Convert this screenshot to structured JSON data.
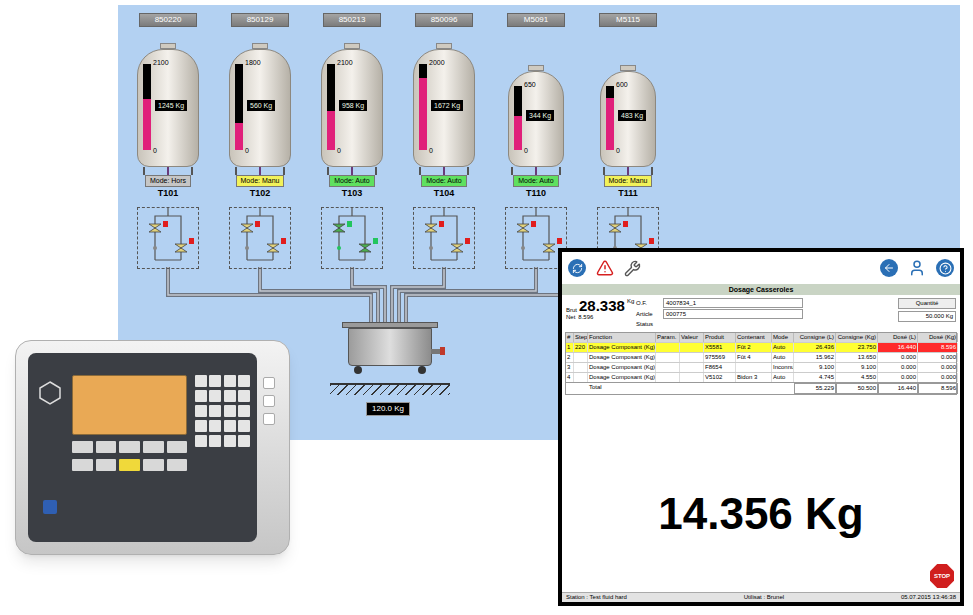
{
  "diagram": {
    "tanks": [
      {
        "code": "850220",
        "max": "2100",
        "min": "0",
        "reading": "1245 Kg",
        "level": 0.593,
        "mode": "Mode: Hors",
        "color": "#c6c6c6",
        "name": "T101",
        "valve_open": false
      },
      {
        "code": "850129",
        "max": "1800",
        "min": "0",
        "reading": "560 Kg",
        "level": 0.311,
        "mode": "Mode: Manu",
        "color": "#f2f25a",
        "name": "T102",
        "valve_open": false
      },
      {
        "code": "850213",
        "max": "2100",
        "min": "0",
        "reading": "958 Kg",
        "level": 0.456,
        "mode": "Mode: Auto",
        "color": "#5fe05f",
        "name": "T103",
        "valve_open": true
      },
      {
        "code": "850096",
        "max": "2000",
        "min": "0",
        "reading": "1672 Kg",
        "level": 0.836,
        "mode": "Mode: Auto",
        "color": "#5fe05f",
        "name": "T104",
        "valve_open": false
      },
      {
        "code": "M5091",
        "max": "650",
        "min": "0",
        "reading": "344 Kg",
        "level": 0.529,
        "mode": "Mode: Auto",
        "color": "#5fe05f",
        "name": "T110",
        "valve_open": false
      },
      {
        "code": "M5115",
        "max": "600",
        "min": "0",
        "reading": "483 Kg",
        "level": 0.805,
        "mode": "Mode: Manu",
        "color": "#f2f25a",
        "name": "T111",
        "valve_open": false
      }
    ],
    "mixer": {
      "reading": "120.0 Kg"
    }
  },
  "tablet": {
    "title": "Dosage Casseroles",
    "brut": {
      "label": "Brut",
      "value": "28.338",
      "unit": "Kg"
    },
    "net": {
      "label": "Net",
      "value": "8.596"
    },
    "fields": [
      {
        "label": "O.F.",
        "value": "4007834_1",
        "boxed": true
      },
      {
        "label": "Article",
        "value": "000775",
        "boxed": true
      },
      {
        "label": "Status",
        "value": "",
        "boxed": false
      }
    ],
    "quantity": {
      "label": "Quantité",
      "value": "50.000 Kg"
    },
    "table": {
      "columns": [
        "#",
        "Step",
        "Fonction",
        "Param.",
        "Valeur",
        "Produit",
        "Contenant",
        "Mode",
        "Consigne (L)",
        "Consigne (Kg)",
        "Dosé (L)",
        "Dosé (Kg)"
      ],
      "rows": [
        {
          "cells": [
            "1",
            "220",
            "Dosage Composant (Kg)",
            "",
            "",
            "X5581",
            "Fût 2",
            "Auto",
            "26.436",
            "23.750",
            "16.440",
            "8.596"
          ],
          "selected": true,
          "alert": true
        },
        {
          "cells": [
            "2",
            "",
            "Dosage Composant (Kg)",
            "",
            "",
            "975569",
            "Fût 4",
            "Auto",
            "15.962",
            "13.650",
            "0.000",
            "0.000"
          ],
          "selected": false,
          "alert": false
        },
        {
          "cells": [
            "3",
            "",
            "Dosage Composant (Kg)",
            "",
            "",
            "F8654",
            "",
            "Inconnu",
            "9.100",
            "9.100",
            "0.000",
            "0.000"
          ],
          "selected": false,
          "alert": false
        },
        {
          "cells": [
            "4",
            "",
            "Dosage Composant (Kg)",
            "",
            "",
            "V5102",
            "Bidon 3",
            "Auto",
            "4.745",
            "4.550",
            "0.000",
            "0.000"
          ],
          "selected": false,
          "alert": false
        }
      ],
      "total": [
        "",
        "",
        "Total",
        "",
        "",
        "",
        "",
        "",
        "55.229",
        "50.500",
        "16.440",
        "8.596"
      ]
    },
    "big_reading": "14.356 Kg",
    "stop": "STOP",
    "status_bar": [
      "Station : Test fluid hard",
      "Utilisat : Brunel",
      "05.07.2015 13:46:38"
    ]
  }
}
